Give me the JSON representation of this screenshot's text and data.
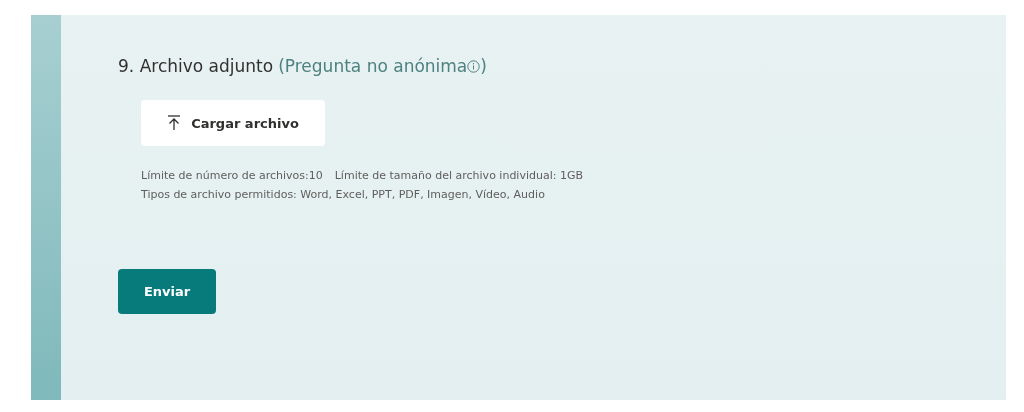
{
  "question": {
    "number": "9.",
    "title": "Archivo adjunto",
    "note": "(Pregunta no anónima",
    "note_end": ")"
  },
  "upload_button": {
    "label": "Cargar archivo"
  },
  "limits": [
    "Límite de número de archivos:10",
    "Límite de tamaño del archivo individual: 1GB"
  ],
  "allowed_types": "Tipos de archivo permitidos: Word, Excel, PPT, PDF, Imagen, Vídeo, Audio",
  "submit_button": {
    "label": "Enviar"
  }
}
